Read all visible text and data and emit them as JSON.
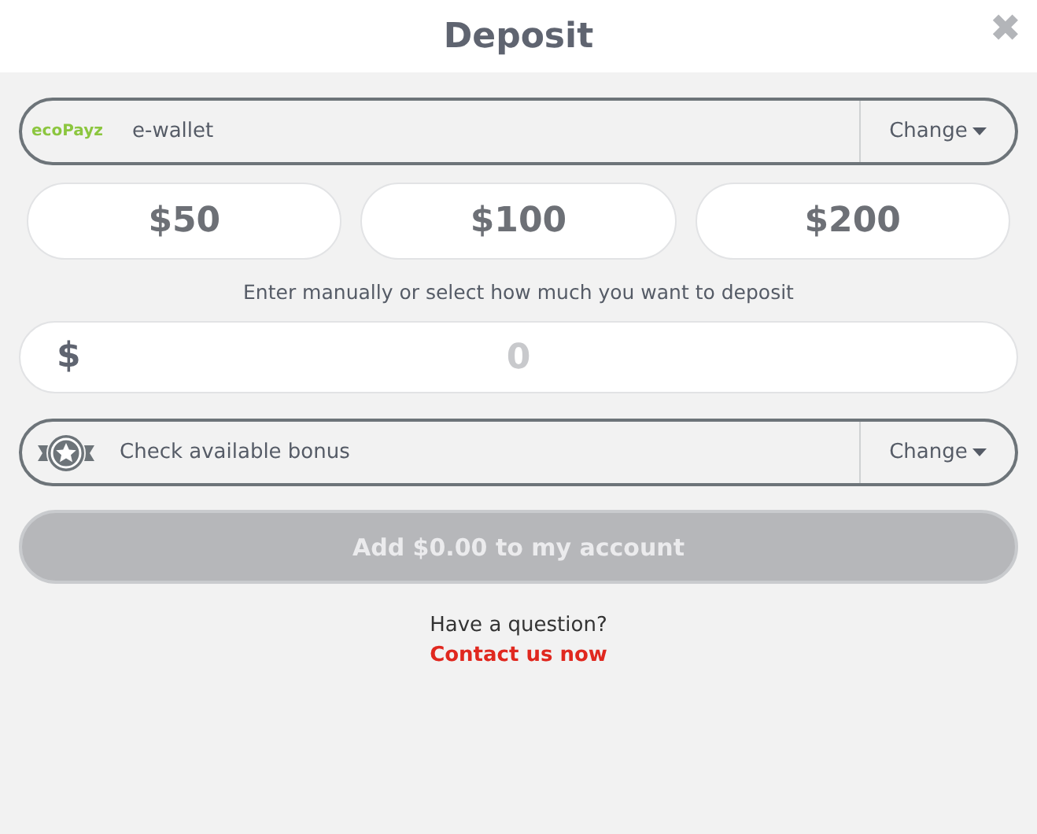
{
  "header": {
    "title": "Deposit",
    "close_icon": "✖"
  },
  "payment_method": {
    "logo_text": "ecoPayz",
    "label": "e-wallet",
    "change": "Change"
  },
  "preset_amounts": [
    {
      "label": "$50",
      "selected": false
    },
    {
      "label": "$100",
      "selected": false
    },
    {
      "label": "$200",
      "selected": false
    }
  ],
  "hint": "Enter manually or select how much you want to deposit",
  "amount_field": {
    "currency": "$",
    "placeholder": "0"
  },
  "bonus": {
    "label": "Check available bonus",
    "change": "Change"
  },
  "submit": {
    "label": "Add $0.00 to my account",
    "disabled": true
  },
  "help": {
    "question": "Have a question?",
    "link": "Contact us now"
  }
}
